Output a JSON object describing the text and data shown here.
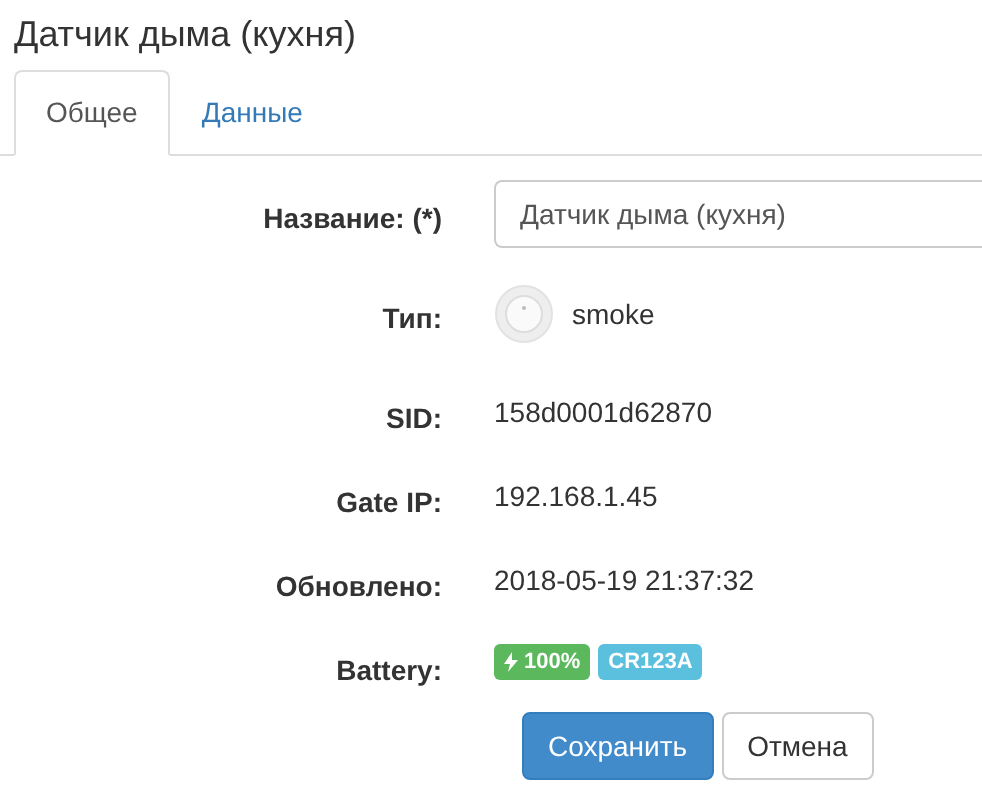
{
  "title": "Датчик дыма (кухня)",
  "tabs": [
    {
      "label": "Общее",
      "selected": true
    },
    {
      "label": "Данные",
      "selected": false
    }
  ],
  "fields": [
    {
      "kind": "input",
      "label": "Название: (*)",
      "value": "Датчик дыма (кухня)"
    },
    {
      "kind": "type",
      "label": "Тип:",
      "value": "smoke"
    },
    {
      "kind": "text",
      "label": "SID:",
      "value": "158d0001d62870"
    },
    {
      "kind": "text",
      "label": "Gate IP:",
      "value": "192.168.1.45"
    },
    {
      "kind": "text",
      "label": "Обновлено:",
      "value": "2018-05-19 21:37:32"
    },
    {
      "kind": "badges",
      "label": "Battery:",
      "badges": [
        {
          "text": "100%",
          "kind": "charge",
          "color": "#5cb85c"
        },
        {
          "text": "CR123A",
          "color": "#5bc0de"
        }
      ]
    }
  ],
  "buttons": [
    {
      "label": "Сохранить",
      "kind": "primary"
    },
    {
      "label": "Отмена",
      "kind": "default"
    }
  ]
}
